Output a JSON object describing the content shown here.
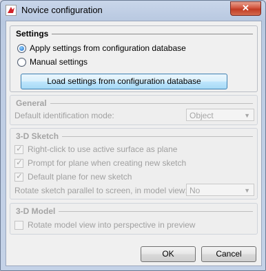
{
  "window": {
    "title": "Novice configuration",
    "close_label": "✕"
  },
  "settings": {
    "legend": "Settings",
    "radio_apply": "Apply settings from configuration database",
    "radio_manual": "Manual settings",
    "load_button": "Load settings from configuration database",
    "selected": "apply"
  },
  "general": {
    "legend": "General",
    "ident_label": "Default identification mode:",
    "ident_value": "Object"
  },
  "sketch": {
    "legend": "3-D Sketch",
    "rightclick_label": "Right-click to use active surface as plane",
    "prompt_label": "Prompt for plane when creating new sketch",
    "default_plane_label": "Default plane for new sketch",
    "rotate_label": "Rotate sketch parallel to screen, in model view:",
    "rotate_value": "No"
  },
  "model": {
    "legend": "3-D Model",
    "perspective_label": "Rotate model view into perspective in preview"
  },
  "footer": {
    "ok": "OK",
    "cancel": "Cancel"
  },
  "colors": {
    "accent_blue": "#1a66c6",
    "close_red": "#c13c24",
    "disabled_text": "#a0a0a0"
  }
}
